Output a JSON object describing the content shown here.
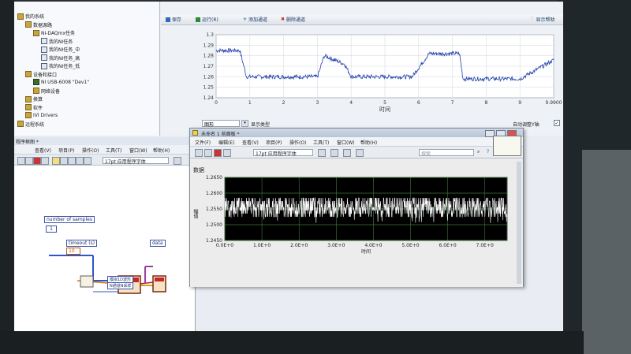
{
  "project_tree": {
    "items": [
      {
        "label": "我的系统",
        "indent": 0
      },
      {
        "label": "数据源路",
        "indent": 1
      },
      {
        "label": "NI-DAQmx任务",
        "indent": 2
      },
      {
        "label": "我的NI任务",
        "indent": 3
      },
      {
        "label": "我的NI任务_中",
        "indent": 3
      },
      {
        "label": "我的NI任务_高",
        "indent": 3
      },
      {
        "label": "我的NI任务_低",
        "indent": 3
      },
      {
        "label": "设备和接口",
        "indent": 1
      },
      {
        "label": "NI USB-6008 \"Dev1\"",
        "indent": 2
      },
      {
        "label": "网络设备",
        "indent": 2
      },
      {
        "label": "换算",
        "indent": 1
      },
      {
        "label": "软件",
        "indent": 1
      },
      {
        "label": "IVI Drivers",
        "indent": 1
      },
      {
        "label": "远程系统",
        "indent": 0
      }
    ]
  },
  "top_panel": {
    "toolbar": {
      "save": "保存",
      "run": "运行(R)",
      "add_channel": "添加通道",
      "delete_channel": "删除通道",
      "show_help": "显示帮助"
    },
    "view_select": "图形",
    "show_options": "显示类型",
    "autoscale_label": "自动调整Y轴"
  },
  "top_graph": {
    "ymin": 1.245,
    "ymax": 1.3,
    "yticks": [
      "1.3",
      "1.29",
      "1.28",
      "1.27",
      "1.26",
      "1.25",
      "1.24"
    ],
    "xticks": [
      "0",
      "1",
      "2",
      "3",
      "4",
      "5",
      "6",
      "7",
      "8",
      "9",
      "9.9900"
    ],
    "xlabel": "时间",
    "color": "#1f3fa8"
  },
  "block_diagram": {
    "title": "程序框图 *",
    "menu": [
      "查看(V)",
      "项目(P)",
      "操作(O)",
      "工具(T)",
      "窗口(W)",
      "帮助(H)"
    ],
    "font_select": "17pt 应用程序字体",
    "number_of_samples_label": "number of samples",
    "number_of_samples_value": "1",
    "timeout_label": "timeout (s)",
    "timeout_value": "10",
    "data_label": "data",
    "analog_read_label": "模拟1D波形",
    "analog_read_sub": "N通道N采样"
  },
  "front_panel": {
    "title": "未命名 1 前面板 *",
    "menu": [
      "文件(F)",
      "编辑(E)",
      "查看(V)",
      "项目(P)",
      "操作(O)",
      "工具(T)",
      "窗口(W)",
      "帮助(H)"
    ],
    "font_select": "17pt 应用程序字体",
    "search_placeholder": "搜索",
    "graph_label": "数据",
    "y_axis_label": "幅值",
    "yticks": [
      "1.2650",
      "1.2600",
      "1.2550",
      "1.2500",
      "1.2450"
    ],
    "xticks": [
      "0.0E+0",
      "1.0E+0",
      "2.0E+0",
      "3.0E+0",
      "4.0E+0",
      "5.0E+0",
      "6.0E+0",
      "7.0E+0"
    ],
    "xlabel": "时间",
    "plot_bg": "#000000",
    "trace_color": "#ffffff"
  }
}
